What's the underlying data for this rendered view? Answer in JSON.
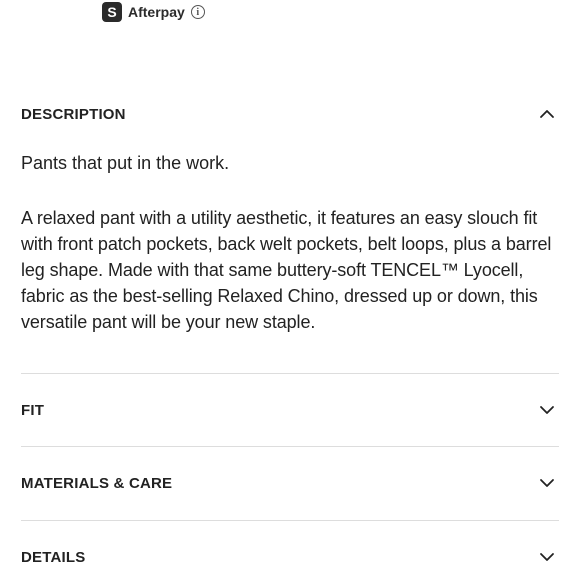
{
  "payment": {
    "afterpay_logo_glyph": "S",
    "afterpay_label": "Afterpay",
    "info_glyph": "i"
  },
  "sections": [
    {
      "title": "DESCRIPTION",
      "expanded": true,
      "icon": "chevron-up-icon"
    },
    {
      "title": "FIT",
      "expanded": false,
      "icon": "chevron-down-icon"
    },
    {
      "title": "MATERIALS & CARE",
      "expanded": false,
      "icon": "chevron-down-icon"
    },
    {
      "title": "DETAILS",
      "expanded": false,
      "icon": "chevron-down-icon"
    }
  ],
  "description": {
    "tagline": "Pants that put in the work.",
    "body": "A relaxed pant with a utility aesthetic, it features an easy slouch fit with front patch pockets, back welt pockets, belt loops, plus a barrel leg shape. Made with that same buttery-soft TENCEL™ Lyocell, fabric as the best-selling Relaxed Chino, dressed up or down, this versatile pant will be your new staple."
  },
  "colors": {
    "text": "#222222",
    "divider": "#dddddd",
    "afterpay_badge": "#2b2b2b"
  }
}
